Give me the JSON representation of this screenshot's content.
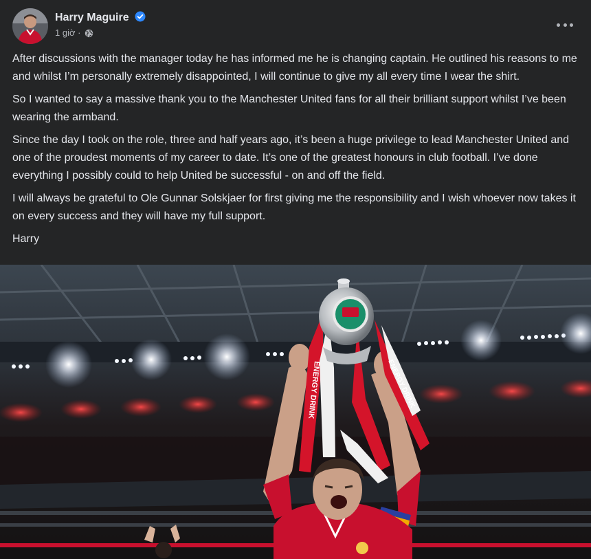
{
  "post": {
    "author": "Harry Maguire",
    "verified": true,
    "timestamp": "1 giờ",
    "separator": "·",
    "audience_icon": "globe-icon",
    "more_icon": "more-options-icon",
    "paragraphs": [
      "After discussions with the manager today he has informed me he is changing captain. He outlined his reasons to me and whilst I’m personally extremely disappointed, I will continue to give my all every time I wear the shirt.",
      "So I wanted to say a massive thank you to the Manchester United fans for all their brilliant support whilst I’ve been wearing the armband.",
      "Since the day I took on the role, three and half years ago, it’s been a huge privilege to lead Manchester United and one of the proudest moments of my career to date. It’s one of the greatest honours in club football. I’ve done everything I possibly could to help United be successful - on and off the field.",
      "I will always be grateful to Ole Gunnar Solskjaer for first giving me the responsibility and I wish whoever now takes it on every success and they will have my full support.",
      "Harry"
    ],
    "photo": {
      "ribbon_text": "ENERGY DRINK",
      "colors": {
        "shirt": "#c8102e",
        "ribbon": "#d4142a",
        "stadium_lights": "#ffffff",
        "stand_glow": "#e0343a",
        "armband": "#f2a900"
      }
    },
    "colors": {
      "background": "#242526",
      "text": "#e4e6eb",
      "secondary_text": "#b0b3b8",
      "verified_badge": "#2d88ff"
    }
  }
}
